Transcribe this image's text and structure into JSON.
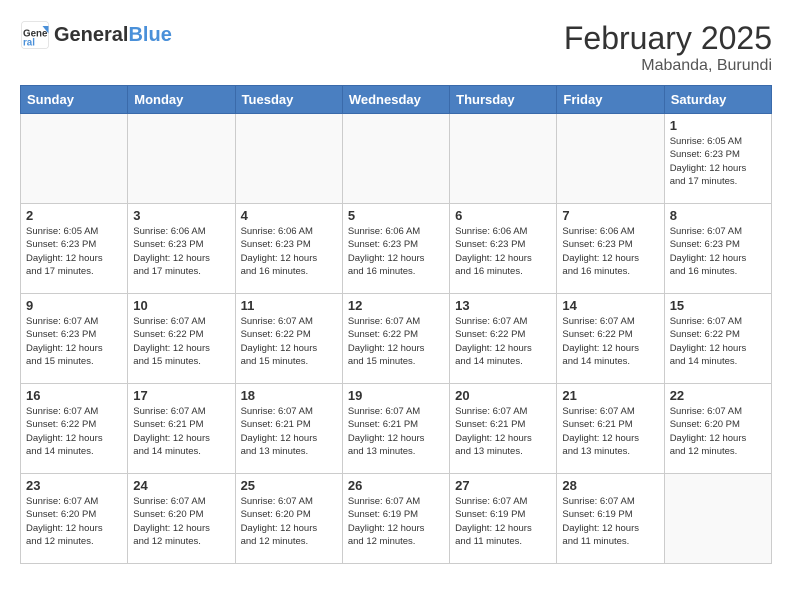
{
  "header": {
    "logo_general": "General",
    "logo_blue": "Blue",
    "month_year": "February 2025",
    "location": "Mabanda, Burundi"
  },
  "days_of_week": [
    "Sunday",
    "Monday",
    "Tuesday",
    "Wednesday",
    "Thursday",
    "Friday",
    "Saturday"
  ],
  "weeks": [
    [
      {
        "day": "",
        "info": ""
      },
      {
        "day": "",
        "info": ""
      },
      {
        "day": "",
        "info": ""
      },
      {
        "day": "",
        "info": ""
      },
      {
        "day": "",
        "info": ""
      },
      {
        "day": "",
        "info": ""
      },
      {
        "day": "1",
        "info": "Sunrise: 6:05 AM\nSunset: 6:23 PM\nDaylight: 12 hours\nand 17 minutes."
      }
    ],
    [
      {
        "day": "2",
        "info": "Sunrise: 6:05 AM\nSunset: 6:23 PM\nDaylight: 12 hours\nand 17 minutes."
      },
      {
        "day": "3",
        "info": "Sunrise: 6:06 AM\nSunset: 6:23 PM\nDaylight: 12 hours\nand 17 minutes."
      },
      {
        "day": "4",
        "info": "Sunrise: 6:06 AM\nSunset: 6:23 PM\nDaylight: 12 hours\nand 16 minutes."
      },
      {
        "day": "5",
        "info": "Sunrise: 6:06 AM\nSunset: 6:23 PM\nDaylight: 12 hours\nand 16 minutes."
      },
      {
        "day": "6",
        "info": "Sunrise: 6:06 AM\nSunset: 6:23 PM\nDaylight: 12 hours\nand 16 minutes."
      },
      {
        "day": "7",
        "info": "Sunrise: 6:06 AM\nSunset: 6:23 PM\nDaylight: 12 hours\nand 16 minutes."
      },
      {
        "day": "8",
        "info": "Sunrise: 6:07 AM\nSunset: 6:23 PM\nDaylight: 12 hours\nand 16 minutes."
      }
    ],
    [
      {
        "day": "9",
        "info": "Sunrise: 6:07 AM\nSunset: 6:23 PM\nDaylight: 12 hours\nand 15 minutes."
      },
      {
        "day": "10",
        "info": "Sunrise: 6:07 AM\nSunset: 6:22 PM\nDaylight: 12 hours\nand 15 minutes."
      },
      {
        "day": "11",
        "info": "Sunrise: 6:07 AM\nSunset: 6:22 PM\nDaylight: 12 hours\nand 15 minutes."
      },
      {
        "day": "12",
        "info": "Sunrise: 6:07 AM\nSunset: 6:22 PM\nDaylight: 12 hours\nand 15 minutes."
      },
      {
        "day": "13",
        "info": "Sunrise: 6:07 AM\nSunset: 6:22 PM\nDaylight: 12 hours\nand 14 minutes."
      },
      {
        "day": "14",
        "info": "Sunrise: 6:07 AM\nSunset: 6:22 PM\nDaylight: 12 hours\nand 14 minutes."
      },
      {
        "day": "15",
        "info": "Sunrise: 6:07 AM\nSunset: 6:22 PM\nDaylight: 12 hours\nand 14 minutes."
      }
    ],
    [
      {
        "day": "16",
        "info": "Sunrise: 6:07 AM\nSunset: 6:22 PM\nDaylight: 12 hours\nand 14 minutes."
      },
      {
        "day": "17",
        "info": "Sunrise: 6:07 AM\nSunset: 6:21 PM\nDaylight: 12 hours\nand 14 minutes."
      },
      {
        "day": "18",
        "info": "Sunrise: 6:07 AM\nSunset: 6:21 PM\nDaylight: 12 hours\nand 13 minutes."
      },
      {
        "day": "19",
        "info": "Sunrise: 6:07 AM\nSunset: 6:21 PM\nDaylight: 12 hours\nand 13 minutes."
      },
      {
        "day": "20",
        "info": "Sunrise: 6:07 AM\nSunset: 6:21 PM\nDaylight: 12 hours\nand 13 minutes."
      },
      {
        "day": "21",
        "info": "Sunrise: 6:07 AM\nSunset: 6:21 PM\nDaylight: 12 hours\nand 13 minutes."
      },
      {
        "day": "22",
        "info": "Sunrise: 6:07 AM\nSunset: 6:20 PM\nDaylight: 12 hours\nand 12 minutes."
      }
    ],
    [
      {
        "day": "23",
        "info": "Sunrise: 6:07 AM\nSunset: 6:20 PM\nDaylight: 12 hours\nand 12 minutes."
      },
      {
        "day": "24",
        "info": "Sunrise: 6:07 AM\nSunset: 6:20 PM\nDaylight: 12 hours\nand 12 minutes."
      },
      {
        "day": "25",
        "info": "Sunrise: 6:07 AM\nSunset: 6:20 PM\nDaylight: 12 hours\nand 12 minutes."
      },
      {
        "day": "26",
        "info": "Sunrise: 6:07 AM\nSunset: 6:19 PM\nDaylight: 12 hours\nand 12 minutes."
      },
      {
        "day": "27",
        "info": "Sunrise: 6:07 AM\nSunset: 6:19 PM\nDaylight: 12 hours\nand 11 minutes."
      },
      {
        "day": "28",
        "info": "Sunrise: 6:07 AM\nSunset: 6:19 PM\nDaylight: 12 hours\nand 11 minutes."
      },
      {
        "day": "",
        "info": ""
      }
    ]
  ]
}
